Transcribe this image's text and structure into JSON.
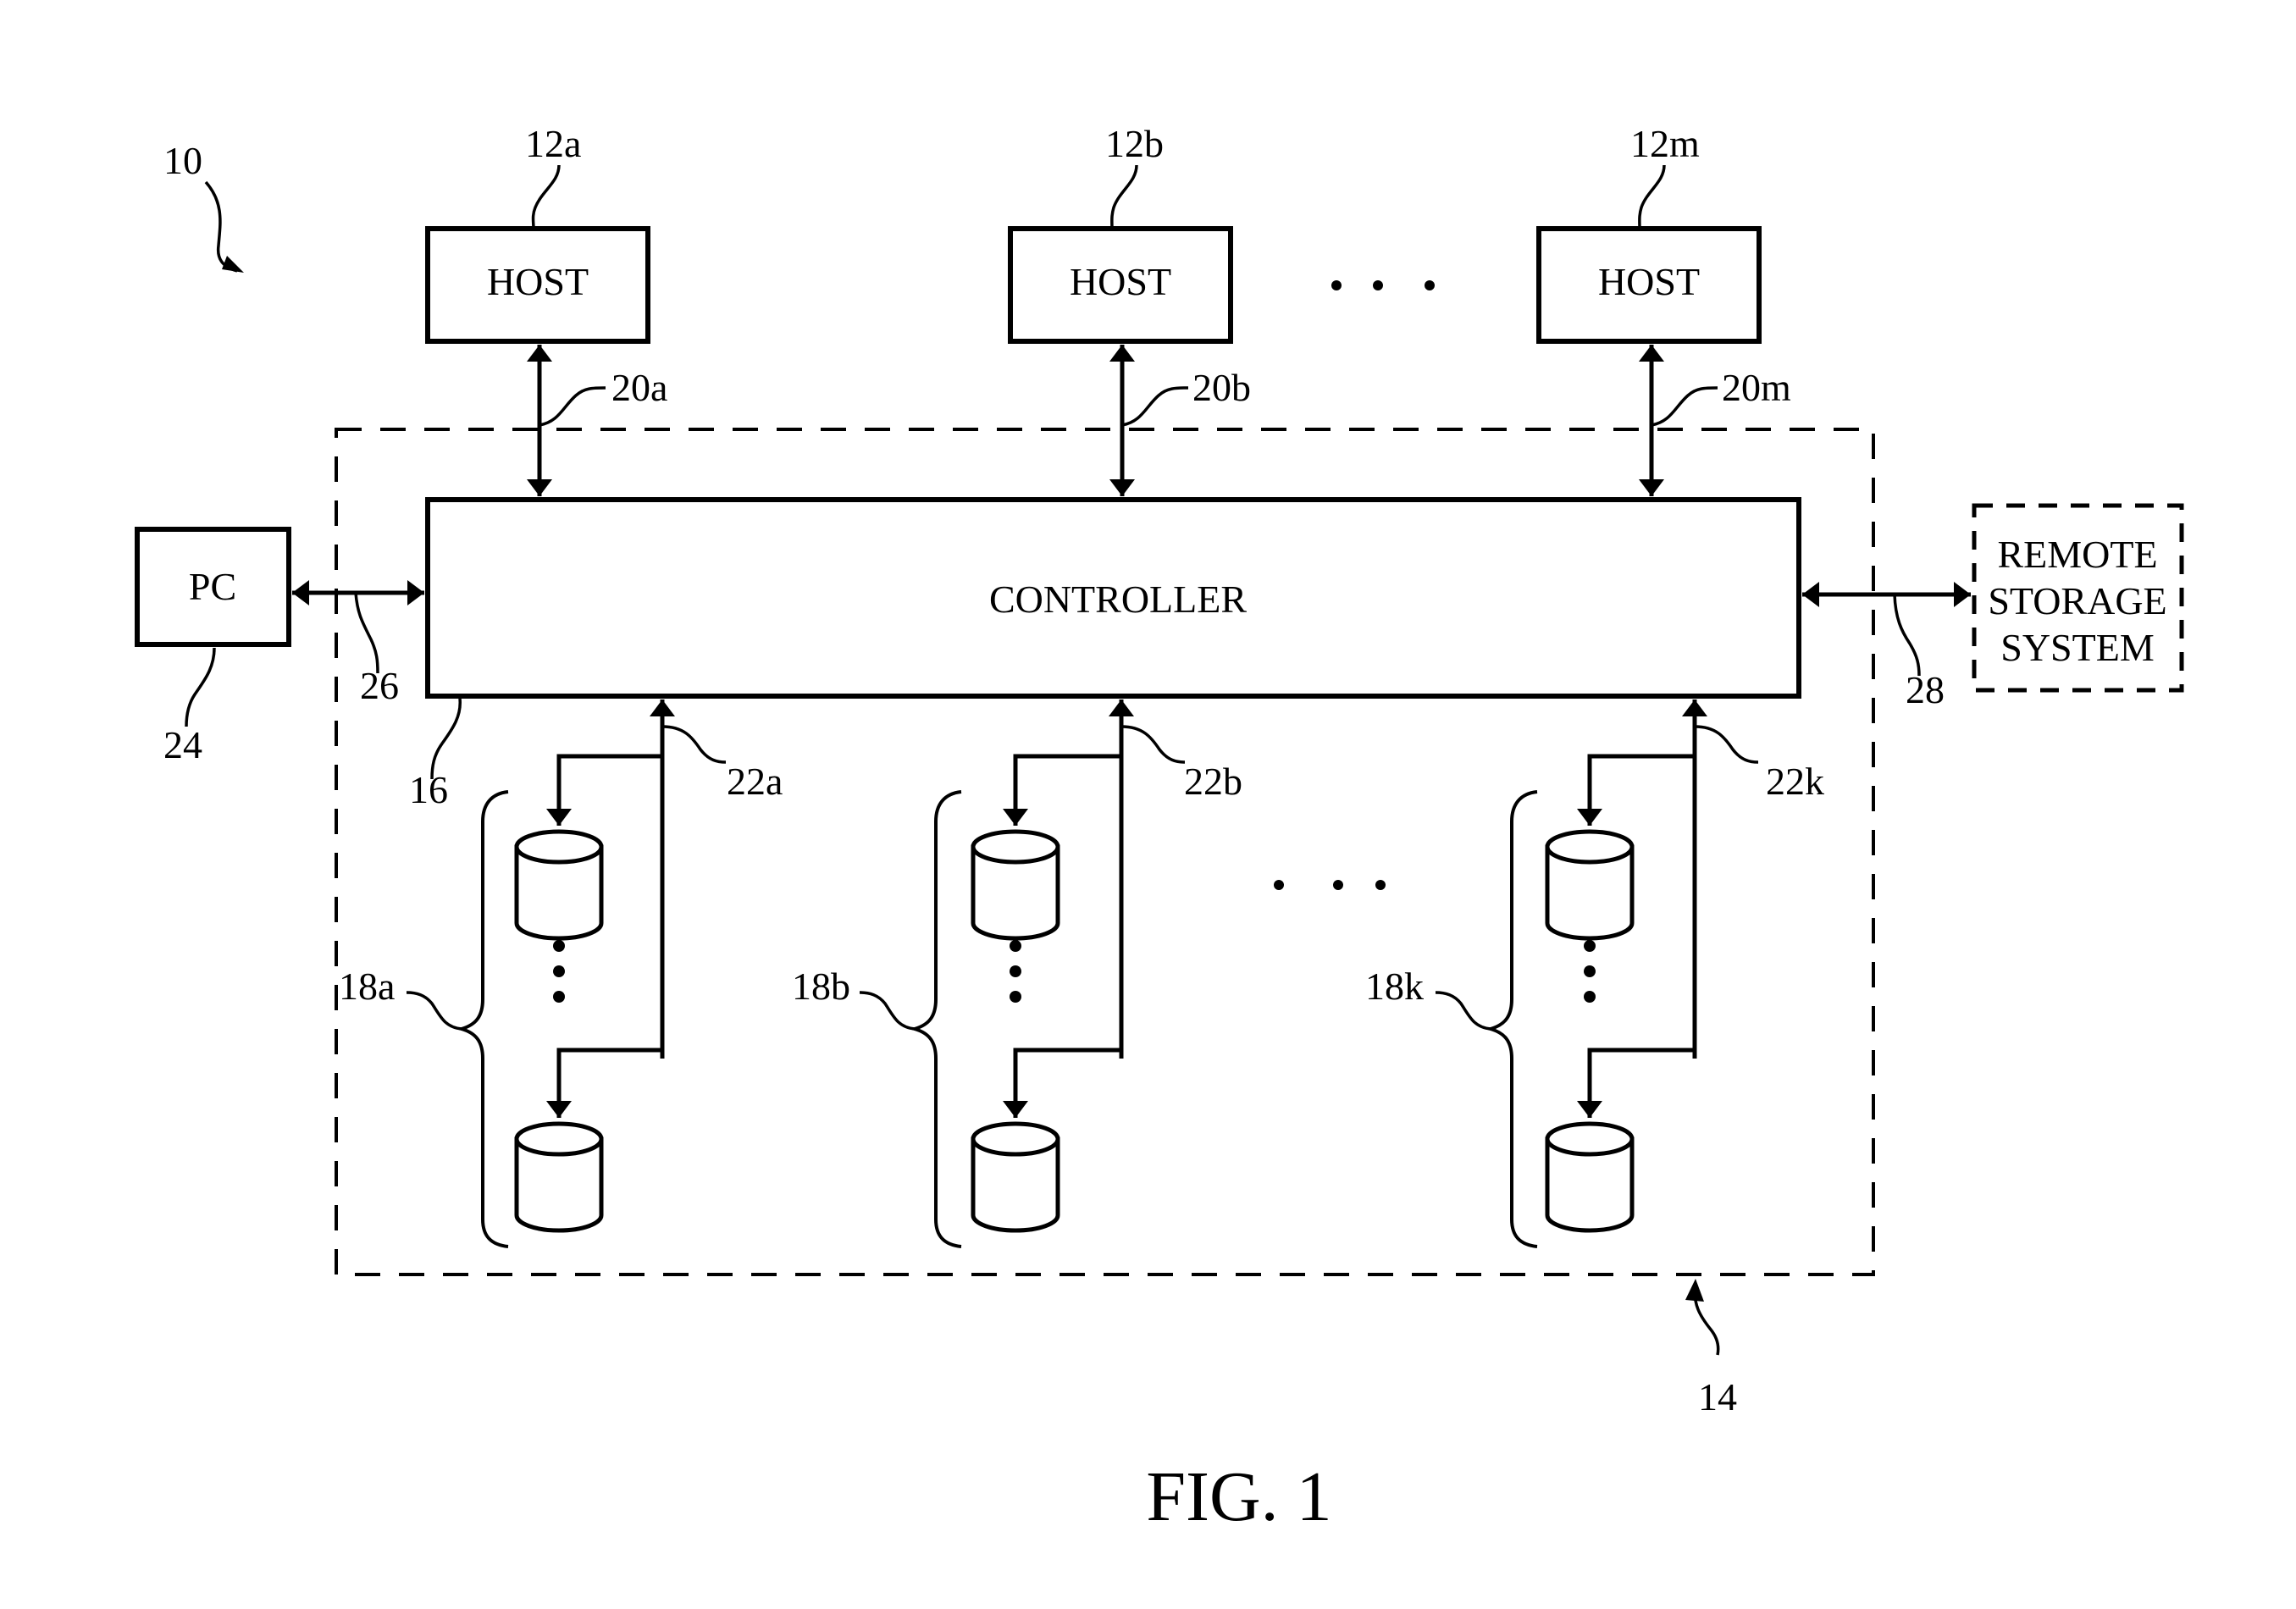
{
  "figure": {
    "caption": "FIG. 1",
    "system_ref": "10",
    "data_storage_system_ref": "14"
  },
  "hosts": [
    {
      "label": "HOST",
      "ref": "12a",
      "link_ref": "20a"
    },
    {
      "label": "HOST",
      "ref": "12b",
      "link_ref": "20b"
    },
    {
      "label": "HOST",
      "ref": "12m",
      "link_ref": "20m"
    }
  ],
  "controller": {
    "label": "CONTROLLER",
    "ref": "16"
  },
  "pc": {
    "label": "PC",
    "ref": "24",
    "link_ref": "26"
  },
  "remote_storage": {
    "lines": [
      "REMOTE",
      "STORAGE",
      "SYSTEM"
    ],
    "link_ref": "28"
  },
  "disk_groups": [
    {
      "ref": "18a",
      "bus_ref": "22a"
    },
    {
      "ref": "18b",
      "bus_ref": "22b"
    },
    {
      "ref": "18k",
      "bus_ref": "22k"
    }
  ]
}
